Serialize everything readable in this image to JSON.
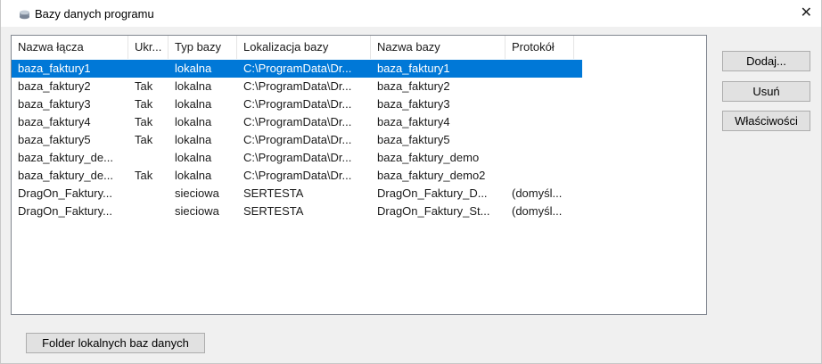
{
  "window": {
    "title": "Bazy danych programu",
    "close_glyph": "✕",
    "title_icon": "database-icon"
  },
  "columns": [
    "Nazwa łącza",
    "Ukr...",
    "Typ bazy",
    "Lokalizacja bazy",
    "Nazwa bazy",
    "Protokół"
  ],
  "rows": [
    {
      "name": "baza_faktury1",
      "hidden": "",
      "type": "lokalna",
      "location": "C:\\ProgramData\\Dr...",
      "db": "baza_faktury1",
      "protocol": ""
    },
    {
      "name": "baza_faktury2",
      "hidden": "Tak",
      "type": "lokalna",
      "location": "C:\\ProgramData\\Dr...",
      "db": "baza_faktury2",
      "protocol": ""
    },
    {
      "name": "baza_faktury3",
      "hidden": "Tak",
      "type": "lokalna",
      "location": "C:\\ProgramData\\Dr...",
      "db": "baza_faktury3",
      "protocol": ""
    },
    {
      "name": "baza_faktury4",
      "hidden": "Tak",
      "type": "lokalna",
      "location": "C:\\ProgramData\\Dr...",
      "db": "baza_faktury4",
      "protocol": ""
    },
    {
      "name": "baza_faktury5",
      "hidden": "Tak",
      "type": "lokalna",
      "location": "C:\\ProgramData\\Dr...",
      "db": "baza_faktury5",
      "protocol": ""
    },
    {
      "name": "baza_faktury_de...",
      "hidden": "",
      "type": "lokalna",
      "location": "C:\\ProgramData\\Dr...",
      "db": "baza_faktury_demo",
      "protocol": ""
    },
    {
      "name": "baza_faktury_de...",
      "hidden": "Tak",
      "type": "lokalna",
      "location": "C:\\ProgramData\\Dr...",
      "db": "baza_faktury_demo2",
      "protocol": ""
    },
    {
      "name": "DragOn_Faktury...",
      "hidden": "",
      "type": "sieciowa",
      "location": "SERTESTA",
      "db": "DragOn_Faktury_D...",
      "protocol": "(domyśl..."
    },
    {
      "name": "DragOn_Faktury...",
      "hidden": "",
      "type": "sieciowa",
      "location": "SERTESTA",
      "db": "DragOn_Faktury_St...",
      "protocol": "(domyśl..."
    }
  ],
  "selected_row": 0,
  "buttons": {
    "add": "Dodaj...",
    "remove": "Usuń",
    "properties": "Właściwości",
    "folder": "Folder lokalnych baz danych"
  },
  "colors": {
    "selection": "#0078d7",
    "dialog_bg": "#f0f0f0",
    "button_bg": "#e1e1e1"
  }
}
